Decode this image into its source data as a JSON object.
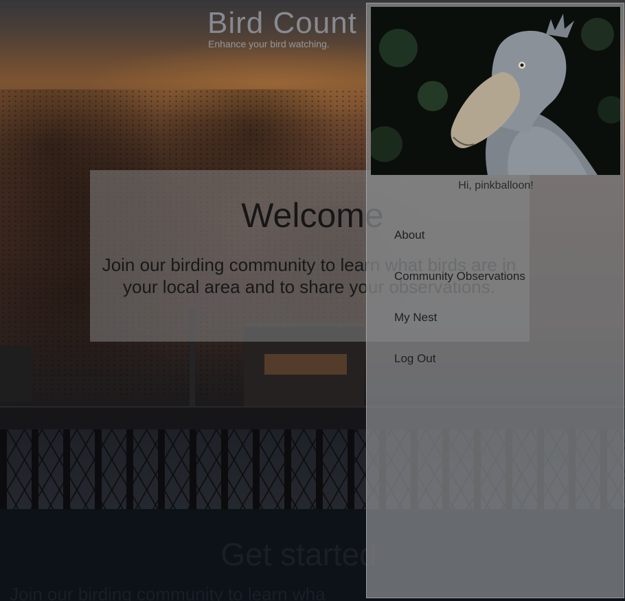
{
  "site": {
    "title": "Bird Count",
    "tagline": "Enhance your bird watching."
  },
  "hero": {
    "welcome_heading": "Welcome",
    "welcome_text": "Join our birding community to learn what birds are in your local area and to share your observations."
  },
  "get_started": {
    "heading": "Get started",
    "text": "Join our birding community to learn wha"
  },
  "drawer": {
    "greeting": "Hi, pinkballoon!",
    "photo_icon": "shoebill-bird-photo",
    "nav": [
      {
        "label": "About"
      },
      {
        "label": "Community Observations"
      },
      {
        "label": "My Nest"
      },
      {
        "label": "Log Out"
      }
    ]
  }
}
